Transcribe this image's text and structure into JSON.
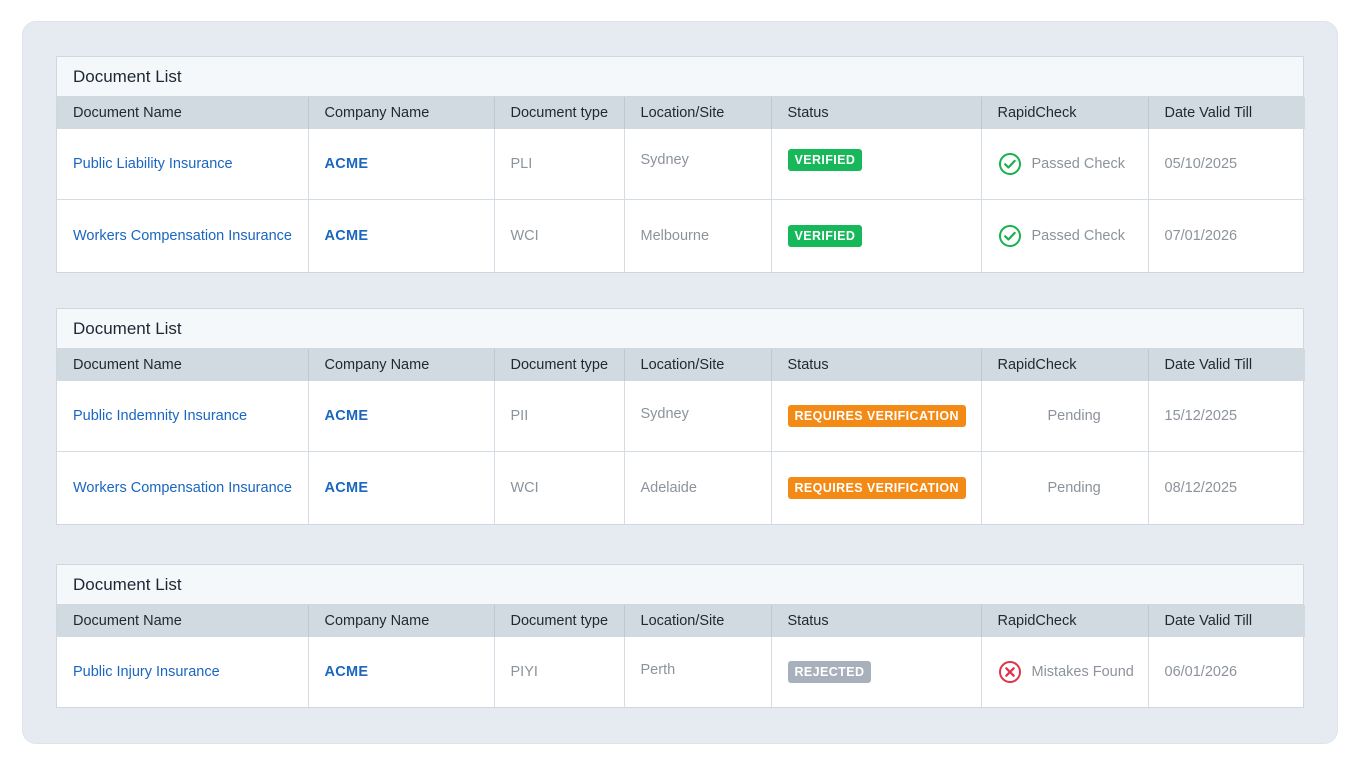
{
  "colors": {
    "verified": "#16b85a",
    "requires_verification": "#f48a16",
    "rejected": "#a8b1bb",
    "link": "#1a66c0",
    "check": "#19b14f",
    "error": "#e0334a"
  },
  "columns": [
    "Document Name",
    "Company Name",
    "Document type",
    "Location/Site",
    "Status",
    "RapidCheck",
    "Date Valid Till"
  ],
  "panels": [
    {
      "title": "Document List",
      "rows": [
        {
          "document_name": "Public Liability Insurance",
          "company": "ACME",
          "doc_type": "PLI",
          "location": "Sydney",
          "status": "VERIFIED",
          "rapidcheck": "Passed Check",
          "rapid_icon": "check-circle-icon",
          "date": "05/10/2025"
        },
        {
          "document_name": "Workers Compensation Insurance",
          "company": "ACME",
          "doc_type": "WCI",
          "location": "Melbourne",
          "status": "VERIFIED",
          "rapidcheck": "Passed Check",
          "rapid_icon": "check-circle-icon",
          "date": "07/01/2026"
        }
      ]
    },
    {
      "title": "Document List",
      "rows": [
        {
          "document_name": "Public Indemnity Insurance",
          "company": "ACME",
          "doc_type": "PII",
          "location": "Sydney",
          "status": "REQUIRES VERIFICATION",
          "rapidcheck": "Pending",
          "rapid_icon": "",
          "date": "15/12/2025"
        },
        {
          "document_name": "Workers Compensation Insurance",
          "company": "ACME",
          "doc_type": "WCI",
          "location": "Adelaide",
          "status": "REQUIRES VERIFICATION",
          "rapidcheck": "Pending",
          "rapid_icon": "",
          "date": "08/12/2025"
        }
      ]
    },
    {
      "title": "Document List",
      "rows": [
        {
          "document_name": "Public Injury Insurance",
          "company": "ACME",
          "doc_type": "PIYI",
          "location": "Perth",
          "status": "REJECTED",
          "rapidcheck": "Mistakes Found",
          "rapid_icon": "x-circle-icon",
          "date": "06/01/2026"
        }
      ]
    }
  ]
}
